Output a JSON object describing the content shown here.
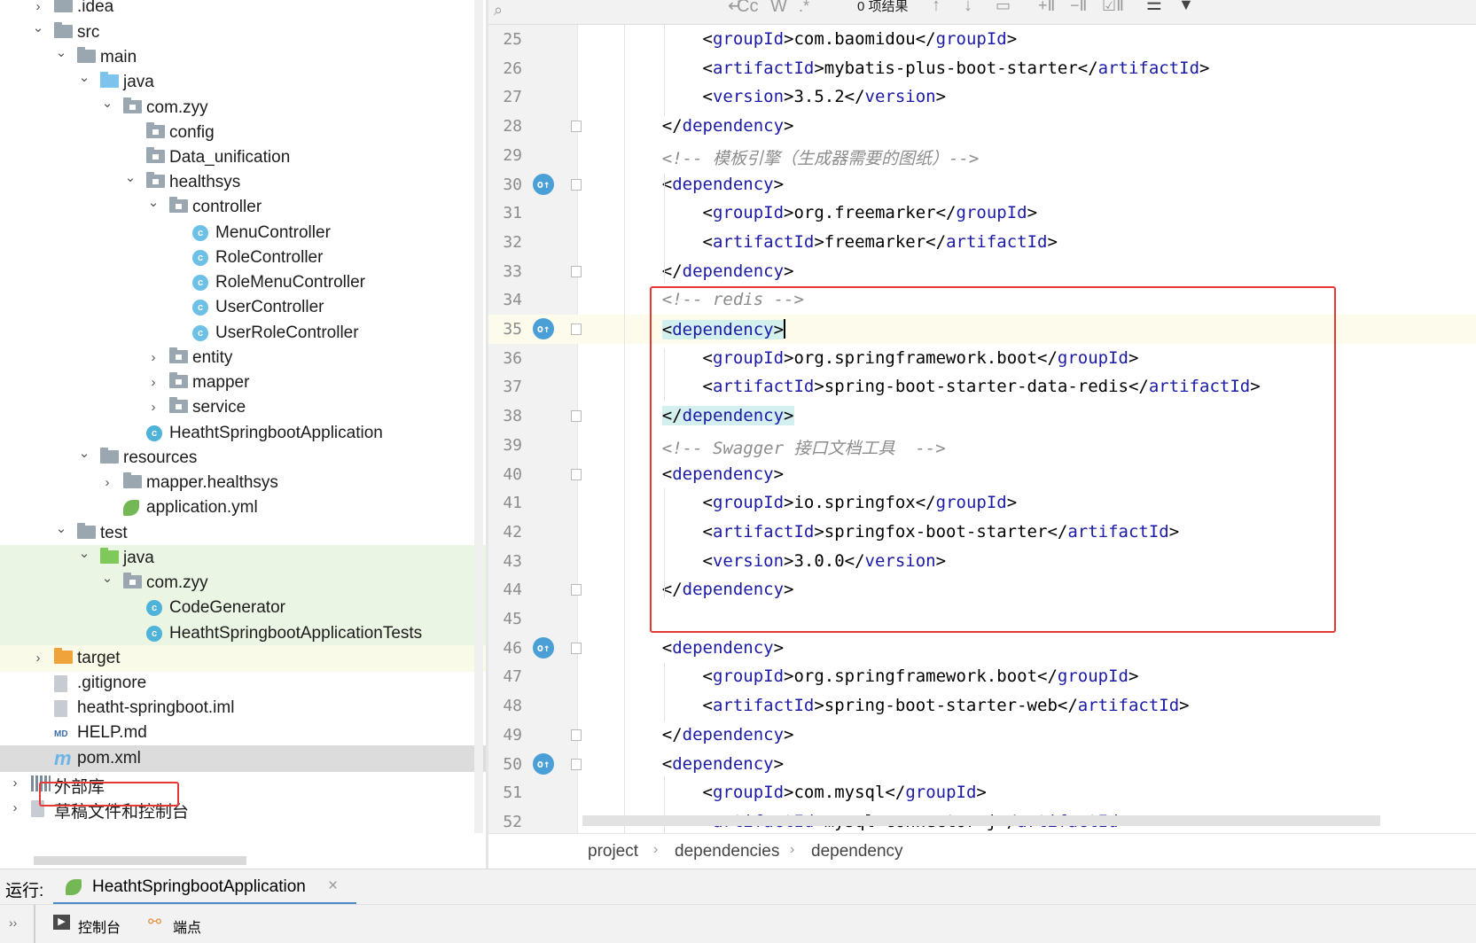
{
  "project_tree": [
    {
      "label": ".idea",
      "icon": "folder-icon"
    },
    {
      "label": "src",
      "icon": "folder-icon"
    },
    {
      "label": "main",
      "icon": "folder-icon"
    },
    {
      "label": "java",
      "icon": "source-folder-icon"
    },
    {
      "label": "com.zyy",
      "icon": "package-icon"
    },
    {
      "label": "config",
      "icon": "package-icon"
    },
    {
      "label": "Data_unification",
      "icon": "package-icon"
    },
    {
      "label": "healthsys",
      "icon": "package-icon"
    },
    {
      "label": "controller",
      "icon": "package-icon"
    },
    {
      "label": "MenuController",
      "icon": "class-icon"
    },
    {
      "label": "RoleController",
      "icon": "class-icon"
    },
    {
      "label": "RoleMenuController",
      "icon": "class-icon"
    },
    {
      "label": "UserController",
      "icon": "class-icon"
    },
    {
      "label": "UserRoleController",
      "icon": "class-icon"
    },
    {
      "label": "entity",
      "icon": "package-icon"
    },
    {
      "label": "mapper",
      "icon": "package-icon"
    },
    {
      "label": "service",
      "icon": "package-icon"
    },
    {
      "label": "HeathtSpringbootApplication",
      "icon": "spring-boot-class-icon"
    },
    {
      "label": "resources",
      "icon": "resources-folder-icon"
    },
    {
      "label": "mapper.healthsys",
      "icon": "folder-icon"
    },
    {
      "label": "application.yml",
      "icon": "spring-config-icon"
    },
    {
      "label": "test",
      "icon": "folder-icon"
    },
    {
      "label": "java",
      "icon": "test-source-folder-icon"
    },
    {
      "label": "com.zyy",
      "icon": "package-icon"
    },
    {
      "label": "CodeGenerator",
      "icon": "runnable-class-icon"
    },
    {
      "label": "HeathtSpringbootApplicationTests",
      "icon": "test-class-icon"
    },
    {
      "label": "target",
      "icon": "excluded-folder-icon"
    },
    {
      "label": ".gitignore",
      "icon": "ignore-file-icon"
    },
    {
      "label": "heatht-springboot.iml",
      "icon": "iml-file-icon"
    },
    {
      "label": "HELP.md",
      "icon": "markdown-icon"
    },
    {
      "label": "pom.xml",
      "icon": "maven-icon"
    },
    {
      "label": "外部库",
      "icon": "libraries-icon"
    },
    {
      "label": "草稿文件和控制台",
      "icon": "scratches-icon"
    }
  ],
  "find_toolbar": {
    "results": "0 项结果",
    "match_case": "Cc",
    "whole_words": "W",
    "regex": ".*"
  },
  "editor_lines": [
    {
      "num": "25",
      "text": "        <groupId>com.baomidou</groupId>"
    },
    {
      "num": "26",
      "text": "        <artifactId>mybatis-plus-boot-starter</artifactId>"
    },
    {
      "num": "27",
      "text": "        <version>3.5.2</version>"
    },
    {
      "num": "28",
      "text": "    </dependency>"
    },
    {
      "num": "29",
      "text": "    <!-- 模板引擎（生成器需要的图纸）-->"
    },
    {
      "num": "30",
      "text": "    <dependency>"
    },
    {
      "num": "31",
      "text": "        <groupId>org.freemarker</groupId>"
    },
    {
      "num": "32",
      "text": "        <artifactId>freemarker</artifactId>"
    },
    {
      "num": "33",
      "text": "    </dependency>"
    },
    {
      "num": "34",
      "text": "    <!-- redis -->"
    },
    {
      "num": "35",
      "text": "    <dependency>"
    },
    {
      "num": "36",
      "text": "        <groupId>org.springframework.boot</groupId>"
    },
    {
      "num": "37",
      "text": "        <artifactId>spring-boot-starter-data-redis</artifactId>"
    },
    {
      "num": "38",
      "text": "    </dependency>"
    },
    {
      "num": "39",
      "text": "    <!-- Swagger 接口文档工具  -->"
    },
    {
      "num": "40",
      "text": "    <dependency>"
    },
    {
      "num": "41",
      "text": "        <groupId>io.springfox</groupId>"
    },
    {
      "num": "42",
      "text": "        <artifactId>springfox-boot-starter</artifactId>"
    },
    {
      "num": "43",
      "text": "        <version>3.0.0</version>"
    },
    {
      "num": "44",
      "text": "    </dependency>"
    },
    {
      "num": "45",
      "text": ""
    },
    {
      "num": "46",
      "text": "    <dependency>"
    },
    {
      "num": "47",
      "text": "        <groupId>org.springframework.boot</groupId>"
    },
    {
      "num": "48",
      "text": "        <artifactId>spring-boot-starter-web</artifactId>"
    },
    {
      "num": "49",
      "text": "    </dependency>"
    },
    {
      "num": "50",
      "text": "    <dependency>"
    },
    {
      "num": "51",
      "text": "        <groupId>com.mysql</groupId>"
    },
    {
      "num": "52",
      "text": "        <artifactId>mysql-connector-j</artifactId>"
    }
  ],
  "breadcrumb": [
    "project",
    "dependencies",
    "dependency"
  ],
  "run_bar": {
    "label": "运行:",
    "config": "HeathtSpringbootApplication",
    "close": "×"
  },
  "bottom_tabs": [
    {
      "label": "控制台",
      "icon": "console-icon"
    },
    {
      "label": "端点",
      "icon": "endpoints-icon"
    }
  ],
  "colors": {
    "tag": "#1a1aa6",
    "comment": "#8c8c8c",
    "highlight": "#d3f0ef",
    "annotation_box": "#e53935",
    "accent": "#4a88c7"
  }
}
